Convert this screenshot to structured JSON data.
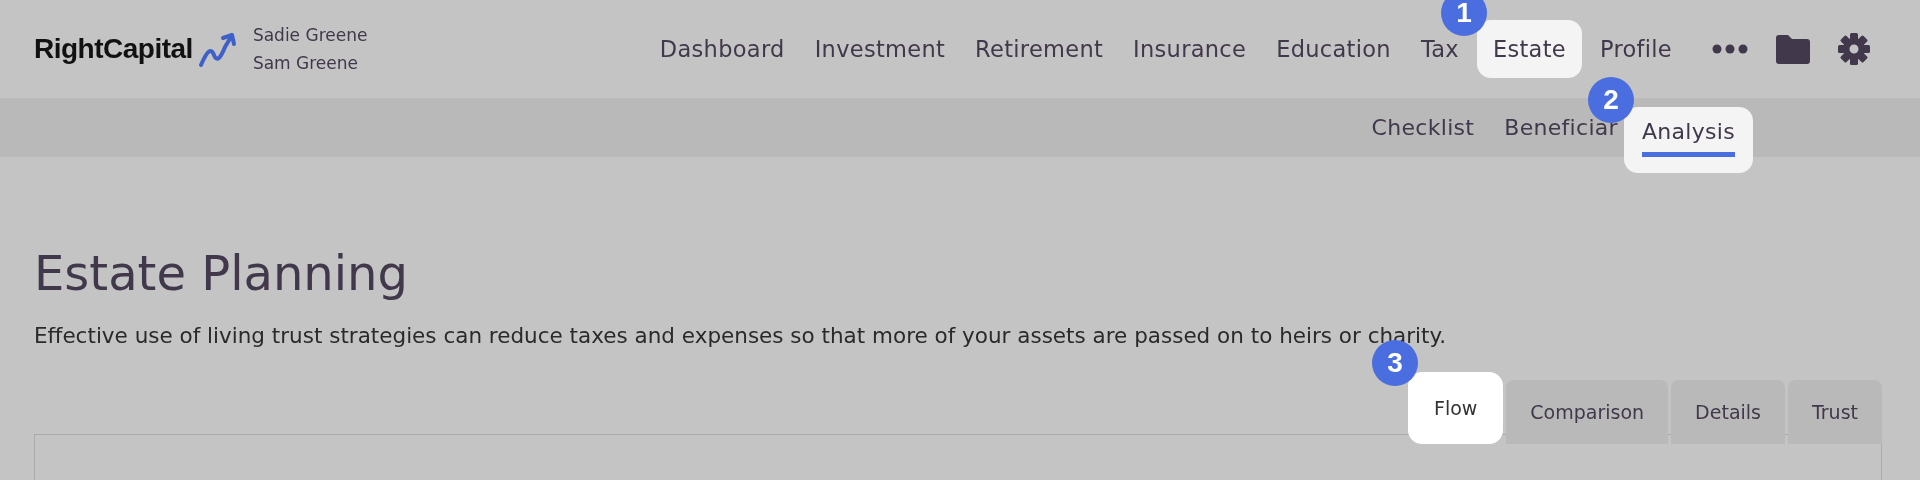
{
  "brand": {
    "name": "RightCapital"
  },
  "household": [
    "Sadie Greene",
    "Sam Greene"
  ],
  "nav": [
    {
      "label": "Dashboard",
      "selected": false
    },
    {
      "label": "Investment",
      "selected": false
    },
    {
      "label": "Retirement",
      "selected": false
    },
    {
      "label": "Insurance",
      "selected": false
    },
    {
      "label": "Education",
      "selected": false
    },
    {
      "label": "Tax",
      "selected": false
    },
    {
      "label": "Estate",
      "selected": true,
      "step": "1"
    },
    {
      "label": "Profile",
      "selected": false
    }
  ],
  "subnav": [
    {
      "label": "Checklist",
      "selected": false
    },
    {
      "label": "Beneficiar",
      "selected": false
    },
    {
      "label": "Analysis",
      "selected": true,
      "step": "2"
    }
  ],
  "page": {
    "title": "Estate Planning",
    "description": "Effective use of living trust strategies can reduce taxes and expenses so that more of your assets are passed on to heirs or charity."
  },
  "view_tabs": [
    {
      "label": "Flow",
      "selected": true,
      "step": "3"
    },
    {
      "label": "Comparison",
      "selected": false
    },
    {
      "label": "Details",
      "selected": false
    },
    {
      "label": "Trust",
      "selected": false
    }
  ]
}
